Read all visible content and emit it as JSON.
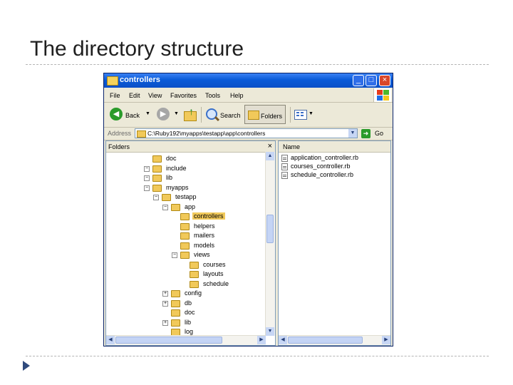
{
  "slide": {
    "title": "The directory structure"
  },
  "window": {
    "title": "controllers",
    "buttons": {
      "minimize": "_",
      "maximize": "□",
      "close": "×"
    },
    "menu": [
      "File",
      "Edit",
      "View",
      "Favorites",
      "Tools",
      "Help"
    ],
    "toolbar": {
      "back": "Back",
      "search": "Search",
      "folders": "Folders"
    },
    "address": {
      "label": "Address",
      "value": "C:\\Ruby192\\myapps\\testapp\\app\\controllers",
      "go": "Go"
    },
    "folders_pane": {
      "header": "Folders",
      "close": "×",
      "tree": [
        {
          "label": "doc",
          "depth": 1,
          "expander": ""
        },
        {
          "label": "include",
          "depth": 1,
          "expander": "−"
        },
        {
          "label": "lib",
          "depth": 1,
          "expander": "−"
        },
        {
          "label": "myapps",
          "depth": 1,
          "expander": "−"
        },
        {
          "label": "testapp",
          "depth": 2,
          "expander": "−"
        },
        {
          "label": "app",
          "depth": 3,
          "expander": "−"
        },
        {
          "label": "controllers",
          "depth": 4,
          "expander": "",
          "selected": true
        },
        {
          "label": "helpers",
          "depth": 4,
          "expander": ""
        },
        {
          "label": "mailers",
          "depth": 4,
          "expander": ""
        },
        {
          "label": "models",
          "depth": 4,
          "expander": ""
        },
        {
          "label": "views",
          "depth": 4,
          "expander": "−"
        },
        {
          "label": "courses",
          "depth": 5,
          "expander": ""
        },
        {
          "label": "layouts",
          "depth": 5,
          "expander": ""
        },
        {
          "label": "schedule",
          "depth": 5,
          "expander": ""
        },
        {
          "label": "config",
          "depth": 3,
          "expander": "+"
        },
        {
          "label": "db",
          "depth": 3,
          "expander": "+"
        },
        {
          "label": "doc",
          "depth": 3,
          "expander": ""
        },
        {
          "label": "lib",
          "depth": 3,
          "expander": "+"
        },
        {
          "label": "log",
          "depth": 3,
          "expander": ""
        }
      ]
    },
    "files_pane": {
      "column_header": "Name",
      "files": [
        "application_controller.rb",
        "courses_controller.rb",
        "schedule_controller.rb"
      ]
    }
  }
}
